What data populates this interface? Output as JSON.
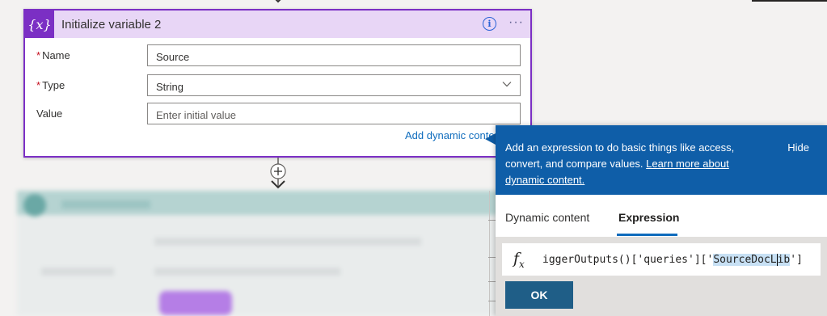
{
  "card": {
    "title": "Initialize variable 2",
    "icon": "variable-icon",
    "icon_text": "{x}",
    "accent": "#7b2fc4",
    "header_bg": "#e8d6f6",
    "fields": {
      "name_label": "Name",
      "name_value": "Source",
      "type_label": "Type",
      "type_value": "String",
      "value_label": "Value",
      "value_placeholder": "Enter initial value",
      "required_mark": "*"
    },
    "dynamic_link": "Add dynamic conte"
  },
  "popup": {
    "description": "Add an expression to do basic things like access, convert, and compare values.",
    "learn_more": "Learn more about dynamic content.",
    "hide_label": "Hide",
    "tabs": [
      "Dynamic content",
      "Expression"
    ],
    "active_tab": "Expression",
    "fx_symbol": "fx",
    "expression_prefix": "iggerOutputs()['queries']['",
    "expression_highlight_a": "SourceDocL",
    "expression_highlight_b": "ib",
    "expression_suffix": "']",
    "ok_label": "OK",
    "header_bg": "#0f5ea8"
  }
}
